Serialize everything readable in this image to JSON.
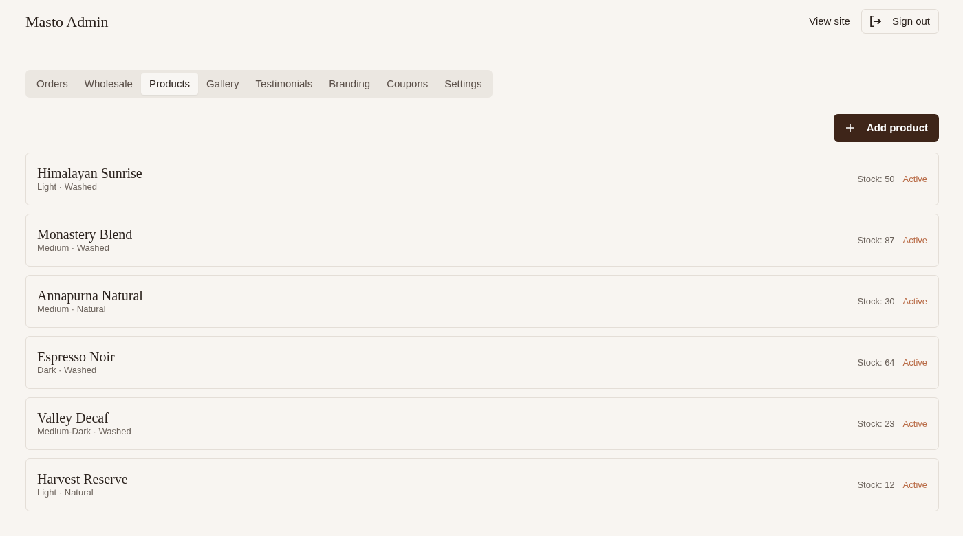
{
  "header": {
    "logo": "Masto Admin",
    "view_site": "View site",
    "sign_out": "Sign out"
  },
  "tabs": [
    {
      "label": "Orders",
      "selected": false
    },
    {
      "label": "Wholesale",
      "selected": false
    },
    {
      "label": "Products",
      "selected": true
    },
    {
      "label": "Gallery",
      "selected": false
    },
    {
      "label": "Testimonials",
      "selected": false
    },
    {
      "label": "Branding",
      "selected": false
    },
    {
      "label": "Coupons",
      "selected": false
    },
    {
      "label": "Settings",
      "selected": false
    }
  ],
  "add_button": "Add product",
  "products": [
    {
      "name": "Himalayan Sunrise",
      "details": "Light · Washed",
      "stock": "Stock: 50",
      "status": "Active"
    },
    {
      "name": "Monastery Blend",
      "details": "Medium · Washed",
      "stock": "Stock: 87",
      "status": "Active"
    },
    {
      "name": "Annapurna Natural",
      "details": "Medium · Natural",
      "stock": "Stock: 30",
      "status": "Active"
    },
    {
      "name": "Espresso Noir",
      "details": "Dark · Washed",
      "stock": "Stock: 64",
      "status": "Active"
    },
    {
      "name": "Valley Decaf",
      "details": "Medium-Dark · Washed",
      "stock": "Stock: 23",
      "status": "Active"
    },
    {
      "name": "Harvest Reserve",
      "details": "Light · Natural",
      "stock": "Stock: 12",
      "status": "Active"
    }
  ]
}
